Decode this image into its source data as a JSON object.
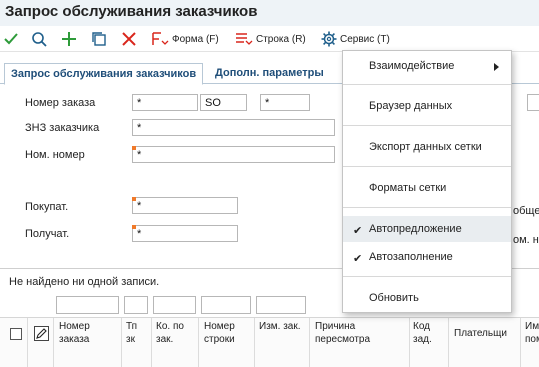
{
  "window": {
    "title": "Запрос обслуживания заказчиков"
  },
  "toolbar": {
    "form_label": "Форма (F)",
    "row_label": "Строка (R)",
    "service_label": "Сервис (T)"
  },
  "tabs": [
    {
      "label": "Запрос обслуживания заказчиков",
      "active": true
    },
    {
      "label": "Дополн. параметры",
      "active": false
    }
  ],
  "form": {
    "order_number_label": "Номер заказа",
    "order_number_value": "*",
    "order_type_value": "SO",
    "order_company_value": "*",
    "customer_order_label": "ЗНЗ заказчика",
    "customer_order_value": "*",
    "item_number_label": "Ном. номер",
    "item_number_value": "*",
    "buyer_label": "Покупат.",
    "buyer_value": "*",
    "recipient_label": "Получат.",
    "recipient_value": "*",
    "right_clip_1": "общее",
    "right_clip_2": "ом. н"
  },
  "grid": {
    "empty_message": "Не найдено ни одной записи.",
    "columns": [
      "Номер заказа",
      "Тп зк",
      "Ко. по зак.",
      "Номер строки",
      "Изм. зак.",
      "Причина пересмотра",
      "Код зад.",
      "Плательщи",
      "Им пом"
    ]
  },
  "menu": {
    "items": [
      {
        "label": "Взаимодействие",
        "submenu": true,
        "checked": false
      },
      {
        "label": "Браузер данных",
        "submenu": false,
        "checked": false
      },
      {
        "label": "Экспорт данных сетки",
        "submenu": false,
        "checked": false
      },
      {
        "label": "Форматы сетки",
        "submenu": false,
        "checked": false
      },
      {
        "label": "Автопредложение",
        "submenu": false,
        "checked": true
      },
      {
        "label": "Автозаполнение",
        "submenu": false,
        "checked": true
      },
      {
        "label": "Обновить",
        "submenu": false,
        "checked": false
      }
    ],
    "checkmark": "✔"
  },
  "colors": {
    "accent_green": "#2e9b3a",
    "accent_blue": "#1f5f8b",
    "delete_red": "#d9261c",
    "required_marker": "#f07a2a",
    "tab_text": "#1f4e79"
  }
}
